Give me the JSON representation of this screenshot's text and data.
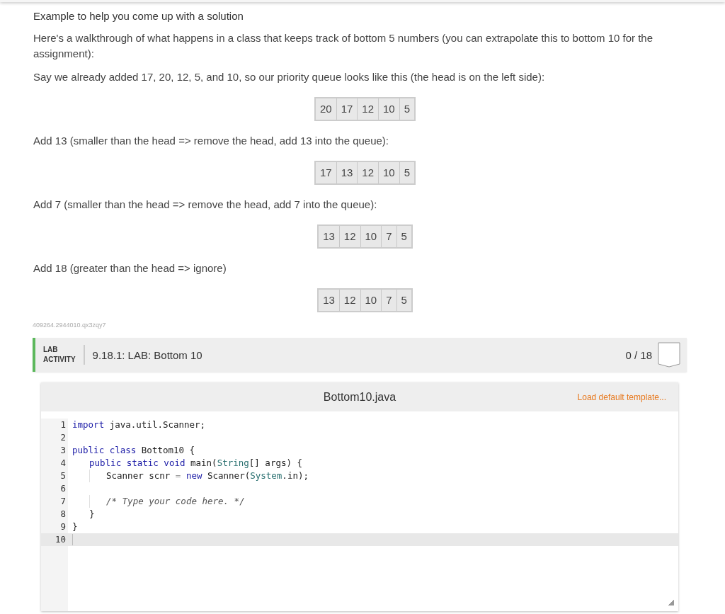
{
  "example": {
    "heading": "Example to help you come up with a solution",
    "steps": [
      {
        "kind": "text",
        "text": "Here's a walkthrough of what happens in a class that keeps track of bottom 5 numbers (you can extrapolate this to bottom 10 for the assignment):"
      },
      {
        "kind": "text",
        "text": "Say we already added 17, 20, 12, 5, and 10, so our priority queue looks like this (the head is on the left side):"
      },
      {
        "kind": "queue",
        "cells": [
          "20",
          "17",
          "12",
          "10",
          "5"
        ]
      },
      {
        "kind": "text",
        "text": "Add 13 (smaller than the head => remove the head, add 13 into the queue):"
      },
      {
        "kind": "queue",
        "cells": [
          "17",
          "13",
          "12",
          "10",
          "5"
        ]
      },
      {
        "kind": "text",
        "text": "Add 7 (smaller than the head => remove the head, add 7 into the queue):"
      },
      {
        "kind": "queue",
        "cells": [
          "13",
          "12",
          "10",
          "7",
          "5"
        ]
      },
      {
        "kind": "text",
        "text": "Add 18 (greater than the head => ignore)"
      },
      {
        "kind": "queue",
        "cells": [
          "13",
          "12",
          "10",
          "7",
          "5"
        ]
      }
    ]
  },
  "content_id": "409264.2944010.qx3zqy7",
  "lab": {
    "label_line_1": "LAB",
    "label_line_2": "ACTIVITY",
    "title": "9.18.1: LAB: Bottom 10",
    "score": "0 / 18",
    "completed": false
  },
  "editor": {
    "filename": "Bottom10.java",
    "load_template": "Load default template...",
    "lines": [
      {
        "number": "1",
        "active": false,
        "tokens": [
          {
            "kind": "keyword",
            "text": "import"
          },
          {
            "kind": "plain",
            "text": " java.util.Scanner;"
          }
        ]
      },
      {
        "number": "2",
        "active": false
      },
      {
        "number": "3",
        "active": false,
        "tokens": [
          {
            "kind": "keyword",
            "text": "public class"
          },
          {
            "kind": "plain",
            "text": " Bottom10 {"
          }
        ]
      },
      {
        "number": "4",
        "active": false,
        "tokens": [
          {
            "kind": "indent"
          },
          {
            "kind": "keyword",
            "text": "public static void"
          },
          {
            "kind": "plain",
            "text": " main("
          },
          {
            "kind": "type",
            "text": "String"
          },
          {
            "kind": "plain",
            "text": "[] args) {"
          }
        ]
      },
      {
        "number": "5",
        "active": false,
        "tokens": [
          {
            "kind": "indent"
          },
          {
            "kind": "indent"
          },
          {
            "kind": "plain",
            "text": "Scanner scnr "
          },
          {
            "kind": "operator",
            "text": "="
          },
          {
            "kind": "keyword",
            "text": "new"
          },
          {
            "kind": "plain",
            "text": " Scanner("
          },
          {
            "kind": "type",
            "text": "System"
          },
          {
            "kind": "plain",
            "text": ".in);"
          }
        ]
      },
      {
        "number": "6",
        "active": false
      },
      {
        "number": "7",
        "active": false,
        "tokens": [
          {
            "kind": "indent"
          },
          {
            "kind": "indent"
          },
          {
            "kind": "comment",
            "text": "/* Type your code here. */"
          }
        ]
      },
      {
        "number": "8",
        "active": false,
        "tokens": [
          {
            "kind": "indent"
          },
          {
            "kind": "plain",
            "text": "}"
          }
        ]
      },
      {
        "number": "9",
        "active": false,
        "tokens": [
          {
            "kind": "plain",
            "text": "}"
          }
        ]
      },
      {
        "number": "10",
        "active": true
      }
    ]
  }
}
